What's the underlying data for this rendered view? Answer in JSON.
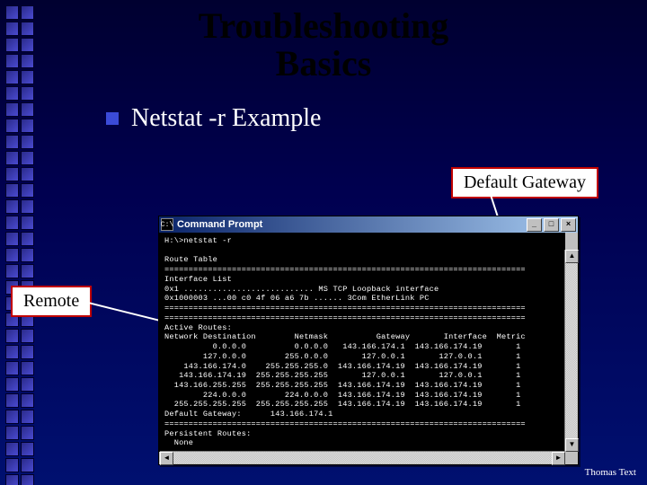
{
  "title_line1": "Troubleshooting",
  "title_line2": "Basics",
  "bullet": "Netstat -r Example",
  "callouts": {
    "gateway": "Default Gateway",
    "remote": "Remote"
  },
  "footer": "Thomas Text",
  "cmdwin": {
    "caption": "Command Prompt",
    "btn_min": "_",
    "btn_max": "□",
    "btn_close": "×",
    "icon_glyph": "C:\\"
  },
  "terminal_lines": [
    "H:\\>netstat -r",
    "",
    "Route Table",
    "===========================================================================",
    "Interface List",
    "0x1 ........................... MS TCP Loopback interface",
    "0x1000003 ...00 c0 4f 06 a6 7b ...... 3Com EtherLink PC",
    "===========================================================================",
    "===========================================================================",
    "Active Routes:",
    "Network Destination        Netmask          Gateway       Interface  Metric",
    "          0.0.0.0          0.0.0.0   143.166.174.1  143.166.174.19       1",
    "        127.0.0.0        255.0.0.0       127.0.0.1       127.0.0.1       1",
    "    143.166.174.0    255.255.255.0  143.166.174.19  143.166.174.19       1",
    "   143.166.174.19  255.255.255.255       127.0.0.1       127.0.0.1       1",
    "  143.166.255.255  255.255.255.255  143.166.174.19  143.166.174.19       1",
    "        224.0.0.0        224.0.0.0  143.166.174.19  143.166.174.19       1",
    "  255.255.255.255  255.255.255.255  143.166.174.19  143.166.174.19       1",
    "Default Gateway:      143.166.174.1",
    "===========================================================================",
    "Persistent Routes:",
    "  None"
  ]
}
